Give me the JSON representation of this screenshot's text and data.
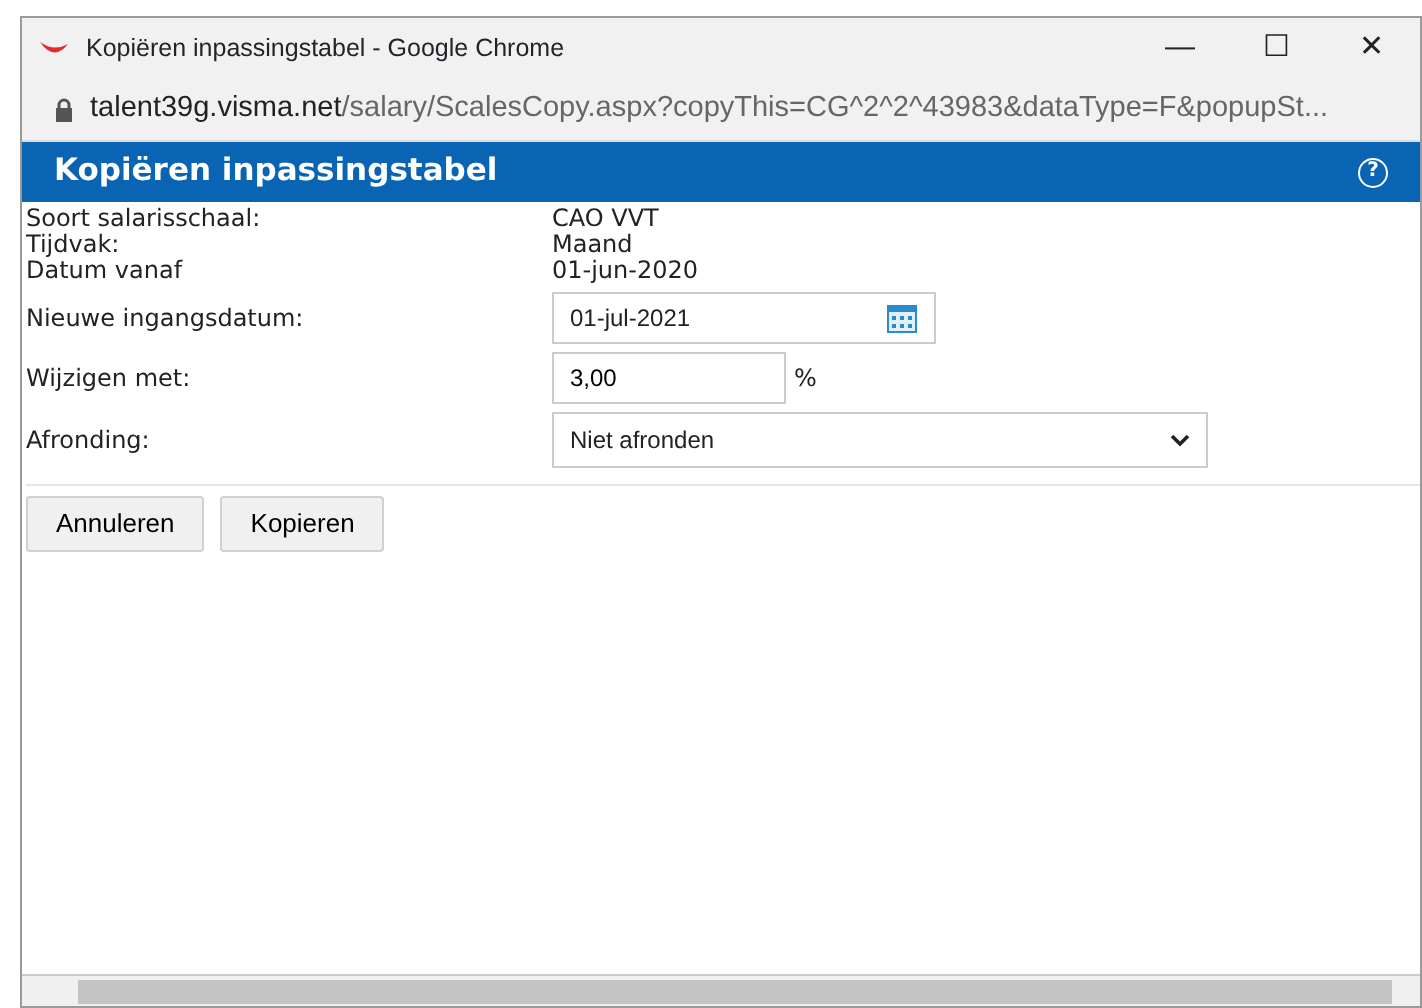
{
  "window": {
    "title": "Kopiëren inpassingstabel - Google Chrome",
    "controls": [
      "—",
      "☐",
      "✕"
    ]
  },
  "address_bar": {
    "host": "talent39g.visma.net",
    "path": "/salary/ScalesCopy.aspx?copyThis=CG^2^2^43983&dataType=F&popupSt..."
  },
  "header": {
    "title": "Kopiëren inpassingstabel",
    "help": "?"
  },
  "info": [
    {
      "label": "Soort salarisschaal:",
      "value": "CAO VVT"
    },
    {
      "label": "Tijdvak:",
      "value": "Maand"
    },
    {
      "label": "Datum vanaf",
      "value": "01-jun-2020"
    }
  ],
  "fields": [
    {
      "kind": "date",
      "label": "Nieuwe ingangsdatum:",
      "value": "01-jul-2021"
    },
    {
      "kind": "number",
      "label": "Wijzigen met:",
      "value": "3,00",
      "unit": "%"
    },
    {
      "kind": "select",
      "label": "Afronding:",
      "value": "Niet afronden"
    }
  ],
  "buttons": [
    "Annuleren",
    "Kopieren"
  ]
}
